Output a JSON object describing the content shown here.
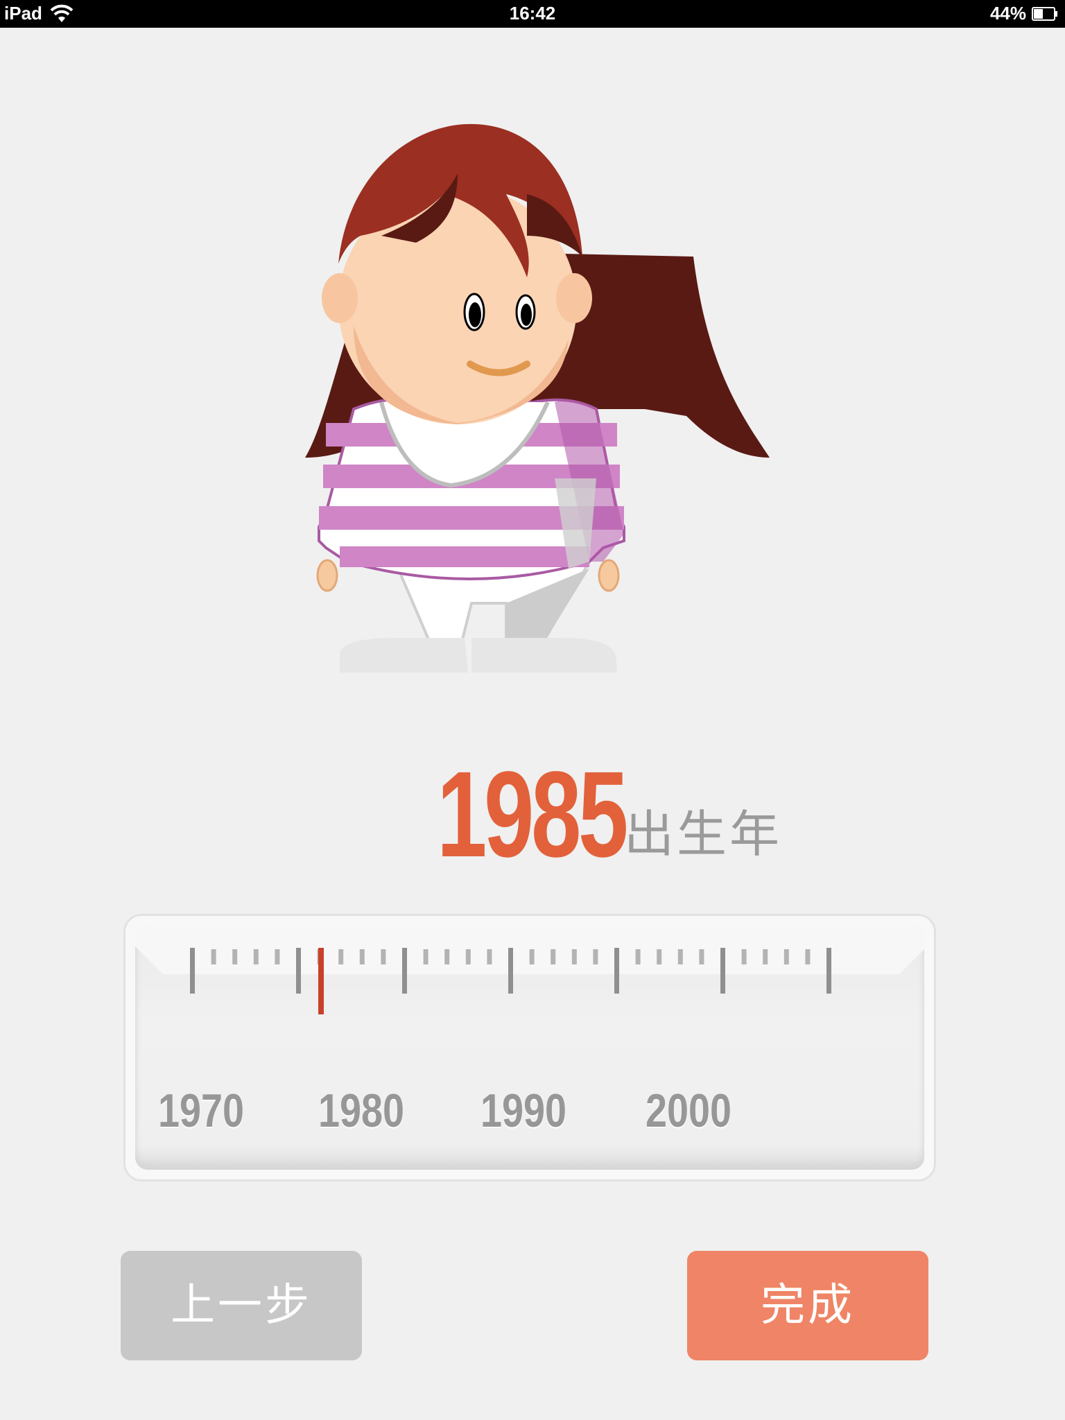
{
  "status_bar": {
    "device": "iPad",
    "time": "16:42",
    "battery": "44%",
    "battery_level": 0.44,
    "wifi_icon": "wifi-icon",
    "battery_icon": "battery-icon"
  },
  "character": {
    "icon": "girl-avatar-illustration",
    "hair_color": "#9b2f22",
    "shirt_color": "#c06db5"
  },
  "birth_year": {
    "value": "1985",
    "suffix": "出生年",
    "value_color": "#e2613a"
  },
  "ruler": {
    "labels": [
      "1970",
      "1980",
      "1990",
      "2000"
    ],
    "indicator_color": "#c9402a"
  },
  "buttons": {
    "back_label": "上一步",
    "done_label": "完成",
    "back_color": "#c7c7c7",
    "done_color": "#ef8566"
  }
}
